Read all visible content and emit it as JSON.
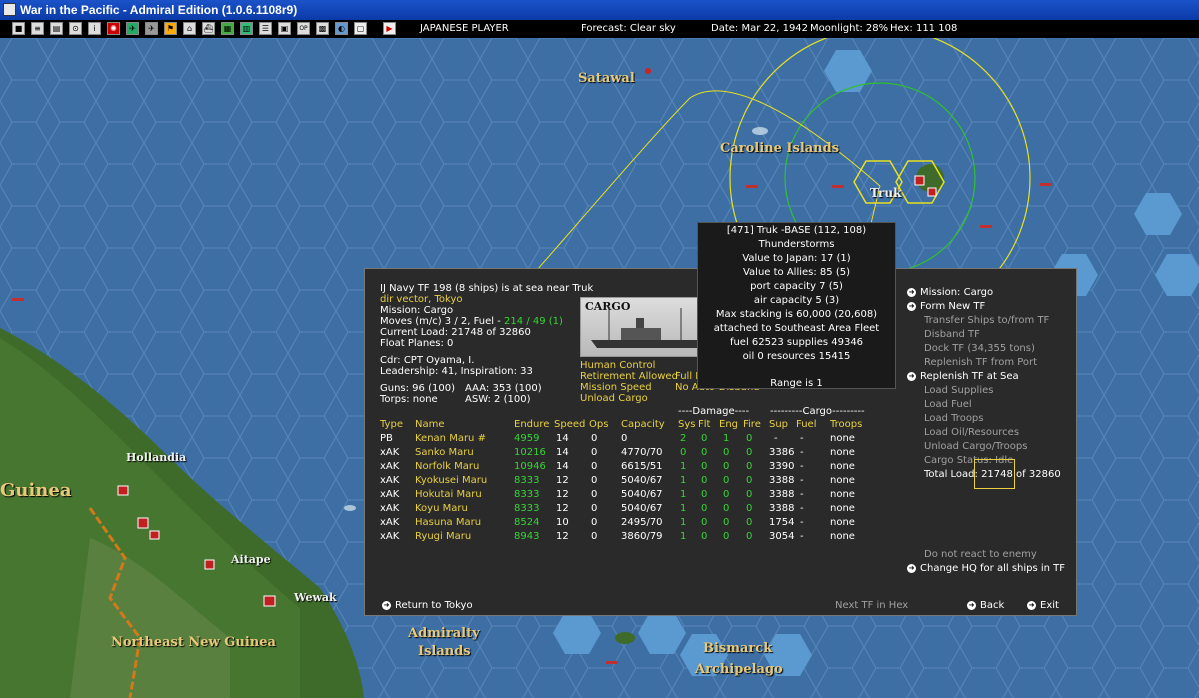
{
  "window": {
    "title": "War in the Pacific - Admiral Edition (1.0.6.1108r9)"
  },
  "toolbar": {
    "player": "JAPANESE PLAYER",
    "forecast": "Forecast: Clear sky",
    "date": "Date: Mar 22, 1942",
    "moonlight": "Moonlight: 28%",
    "hex": "Hex: 111 108",
    "buttons": [
      "help-icon",
      "list-icon",
      "report-icon",
      "search-icon",
      "info-icon",
      "japan-flag-icon",
      "aircraft-icon",
      "fighter-icon",
      "flag-icon",
      "base-icon",
      "ship-icon",
      "supply-icon",
      "fleet-icon",
      "ground-icon",
      "ops-icon",
      "ws-icon",
      "map-icon",
      "end-turn-icon"
    ]
  },
  "map": {
    "labels": [
      {
        "text": "Satawal",
        "style": "yellow"
      },
      {
        "text": "Caroline Islands",
        "style": "yellow"
      },
      {
        "text": "Truk",
        "style": "white"
      },
      {
        "text": "Hollandia",
        "style": "white"
      },
      {
        "text": "Guinea",
        "style": "big"
      },
      {
        "text": "Aitape",
        "style": "white"
      },
      {
        "text": "Wewak",
        "style": "white"
      },
      {
        "text": "Northeast New Guinea",
        "style": "yellow"
      },
      {
        "text": "Admiralty",
        "style": "yellow"
      },
      {
        "text": "Islands",
        "style": "yellow"
      },
      {
        "text": "Bismarck",
        "style": "yellow"
      },
      {
        "text": "Archipelago",
        "style": "yellow"
      }
    ]
  },
  "tooltip": {
    "lines": [
      "[471] Truk -BASE (112, 108)",
      "Thunderstorms",
      "Value to Japan: 17 (1)",
      "Value to Allies: 85 (5)",
      "port capacity 7 (5)",
      "air capacity 5 (3)",
      "Max stacking is 60,000 (20,608)",
      "attached to Southeast Area Fleet",
      "fuel 62523 supplies 49346",
      "oil 0 resources 15415"
    ],
    "range": "Range is 1"
  },
  "tf": {
    "header": "IJ Navy TF 198 (8 ships) is at sea near Truk",
    "vector": "dir vector, Tokyo",
    "mission": "Mission: Cargo",
    "moves": "Moves (m/c) 3 / 2, Fuel - ",
    "fuel_value": "214 / 49 (1)",
    "load": "Current Load: 21748 of 32860",
    "float_planes": "Float Planes: 0",
    "cdr": "Cdr: CPT Oyama, I.",
    "leadership": "Leadership: 41, Inspiration: 33",
    "guns": "Guns: 96 (100)",
    "aaa": "AAA: 353 (100)",
    "torps": "Torps: none",
    "asw": "ASW: 2 (100)",
    "image_label": "CARGO",
    "opts_left": [
      "Human Control",
      "Retirement Allowed",
      "Mission Speed",
      "Unload Cargo"
    ],
    "opts_right": [
      "Full Refuel",
      "",
      "No Auto-Disband",
      ""
    ]
  },
  "table": {
    "damage_header": "----Damage----",
    "cargo_header": "---------Cargo---------",
    "columns": [
      "Type",
      "Name",
      "Endure",
      "Speed",
      "Ops",
      "Capacity",
      "Sys",
      "Flt",
      "Eng",
      "Fire",
      "Sup",
      "Fuel",
      "Troops"
    ],
    "rows": [
      [
        "PB",
        "Kenan Maru #",
        "4959",
        "14",
        "0",
        "0",
        "2",
        "0",
        "1",
        "0",
        "-",
        "-",
        "none"
      ],
      [
        "xAK",
        "Sanko Maru",
        "10216",
        "14",
        "0",
        "4770/70",
        "0",
        "0",
        "0",
        "0",
        "3386",
        "-",
        "none"
      ],
      [
        "xAK",
        "Norfolk Maru",
        "10946",
        "14",
        "0",
        "6615/51",
        "1",
        "0",
        "0",
        "0",
        "3390",
        "-",
        "none"
      ],
      [
        "xAK",
        "Kyokusei Maru",
        "8333",
        "12",
        "0",
        "5040/67",
        "1",
        "0",
        "0",
        "0",
        "3388",
        "-",
        "none"
      ],
      [
        "xAK",
        "Hokutai Maru",
        "8333",
        "12",
        "0",
        "5040/67",
        "1",
        "0",
        "0",
        "0",
        "3388",
        "-",
        "none"
      ],
      [
        "xAK",
        "Koyu Maru",
        "8333",
        "12",
        "0",
        "5040/67",
        "1",
        "0",
        "0",
        "0",
        "3388",
        "-",
        "none"
      ],
      [
        "xAK",
        "Hasuna Maru",
        "8524",
        "10",
        "0",
        "2495/70",
        "1",
        "0",
        "0",
        "0",
        "1754",
        "-",
        "none"
      ],
      [
        "xAK",
        "Ryugi Maru",
        "8943",
        "12",
        "0",
        "3860/79",
        "1",
        "0",
        "0",
        "0",
        "3054",
        "-",
        "none"
      ]
    ]
  },
  "menu": {
    "items": [
      {
        "label": "Mission: Cargo",
        "active": true,
        "arrow": true
      },
      {
        "label": "Form New TF",
        "active": true,
        "arrow": true
      },
      {
        "label": "Transfer Ships to/from TF",
        "active": false,
        "arrow": false
      },
      {
        "label": "Disband TF",
        "active": false,
        "arrow": false
      },
      {
        "label": "Dock TF (34,355 tons)",
        "active": false,
        "arrow": false
      },
      {
        "label": "Replenish TF from Port",
        "active": false,
        "arrow": false
      },
      {
        "label": "Replenish TF at Sea",
        "active": true,
        "arrow": true
      },
      {
        "label": "Load Supplies",
        "active": false,
        "arrow": false
      },
      {
        "label": "Load Fuel",
        "active": false,
        "arrow": false
      },
      {
        "label": "Load Troops",
        "active": false,
        "arrow": false
      },
      {
        "label": "Load Oil/Resources",
        "active": false,
        "arrow": false
      },
      {
        "label": "Unload Cargo/Troops",
        "active": false,
        "arrow": false
      },
      {
        "label": "Cargo Status: Idle",
        "active": false,
        "arrow": false
      },
      {
        "label": "Total Load: 21748 of 32860",
        "active": true,
        "arrow": false
      }
    ],
    "react": "Do not react to enemy",
    "change_hq": "Change HQ for all ships in TF"
  },
  "footer": {
    "return": "Return to Tokyo",
    "next_tf": "Next TF in Hex",
    "back": "Back",
    "exit": "Exit"
  },
  "colors": {
    "sea": "#3d6fa5",
    "land": "#3f6b2a",
    "panel": "#2a2a2a",
    "highlight": "#e8d040",
    "good": "#36d436"
  }
}
